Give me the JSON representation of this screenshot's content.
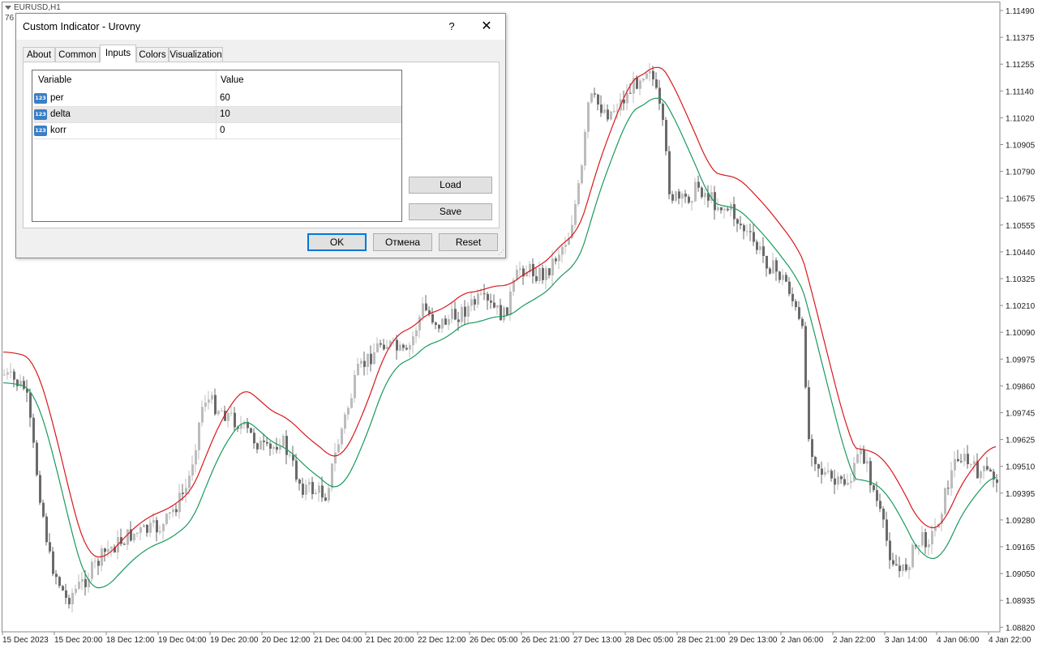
{
  "chart": {
    "symbol": "EURUSD,H1",
    "subtext": "76",
    "price_labels": [
      "1.11490",
      "1.11375",
      "1.11255",
      "1.11140",
      "1.11020",
      "1.10905",
      "1.10790",
      "1.10675",
      "1.10555",
      "1.10440",
      "1.10325",
      "1.10210",
      "1.10090",
      "1.09975",
      "1.09860",
      "1.09745",
      "1.09625",
      "1.09510",
      "1.09395",
      "1.09280",
      "1.09165",
      "1.09050",
      "1.08935",
      "1.08820"
    ],
    "time_labels": [
      "15 Dec 2023",
      "15 Dec 20:00",
      "18 Dec 12:00",
      "19 Dec 04:00",
      "19 Dec 20:00",
      "20 Dec 12:00",
      "21 Dec 04:00",
      "21 Dec 20:00",
      "22 Dec 12:00",
      "26 Dec 05:00",
      "26 Dec 21:00",
      "27 Dec 13:00",
      "28 Dec 05:00",
      "28 Dec 21:00",
      "29 Dec 13:00",
      "2 Jan 06:00",
      "2 Jan 22:00",
      "3 Jan 14:00",
      "4 Jan 06:00",
      "4 Jan 22:00"
    ],
    "colors": {
      "upper_line": "#d7191c",
      "lower_line": "#1a9a5c",
      "candle": "#bcbcbc",
      "candle_dark": "#6a6a6a",
      "axis": "#8a8a8a"
    }
  },
  "dialog": {
    "title": "Custom Indicator - Urovny",
    "help_label": "?",
    "close_label": "✕",
    "tabs": [
      {
        "label": "About"
      },
      {
        "label": "Common"
      },
      {
        "label": "Inputs",
        "active": true
      },
      {
        "label": "Colors"
      },
      {
        "label": "Visualization"
      }
    ],
    "grid": {
      "col_variable": "Variable",
      "col_value": "Value",
      "icon_text": "123",
      "rows": [
        {
          "name": "per",
          "value": "60"
        },
        {
          "name": "delta",
          "value": "10",
          "selected": true
        },
        {
          "name": "korr",
          "value": "0"
        }
      ]
    },
    "buttons": {
      "load": "Load",
      "save": "Save",
      "ok": "OK",
      "cancel": "Отмена",
      "reset": "Reset"
    }
  }
}
